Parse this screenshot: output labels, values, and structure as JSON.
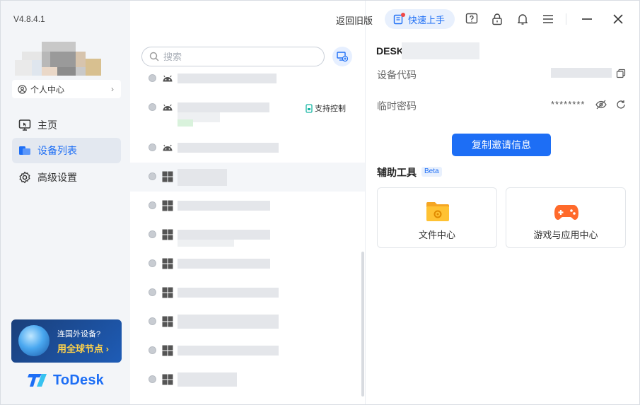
{
  "app": {
    "version": "V4.8.4.1",
    "profile_label": "个人中心",
    "logo_text": "ToDesk"
  },
  "sidebar": {
    "items": [
      {
        "label": "主页",
        "icon": "monitor-icon",
        "active": false
      },
      {
        "label": "设备列表",
        "icon": "devices-icon",
        "active": true
      },
      {
        "label": "高级设置",
        "icon": "gear-icon",
        "active": false
      }
    ],
    "promo": {
      "line1": "连国外设备?",
      "line2": "用全球节点"
    }
  },
  "toolbar": {
    "back_old_label": "返回旧版",
    "quick_start_label": "快速上手"
  },
  "device_list": {
    "search_placeholder": "搜索",
    "support_control_badge": "支持控制",
    "rows": [
      {
        "os": "android"
      },
      {
        "os": "android",
        "badge": true
      },
      {
        "os": "android"
      },
      {
        "os": "windows",
        "highlight": true
      },
      {
        "os": "windows"
      },
      {
        "os": "windows"
      },
      {
        "os": "windows"
      },
      {
        "os": "windows"
      },
      {
        "os": "windows"
      },
      {
        "os": "windows"
      },
      {
        "os": "windows"
      }
    ]
  },
  "device_panel": {
    "device_name_prefix": "DESK",
    "device_code_label": "设备代码",
    "temp_password_label": "临时密码",
    "temp_password_value": "********",
    "copy_invite_label": "复制邀请信息",
    "tools_title": "辅助工具",
    "beta_label": "Beta",
    "tools": [
      {
        "label": "文件中心",
        "icon": "folder-icon"
      },
      {
        "label": "游戏与应用中心",
        "icon": "gamepad-icon"
      }
    ]
  },
  "colors": {
    "accent": "#1d6ef5",
    "sidebar_bg": "#f3f5f8",
    "promo_highlight": "#ffd24a"
  }
}
